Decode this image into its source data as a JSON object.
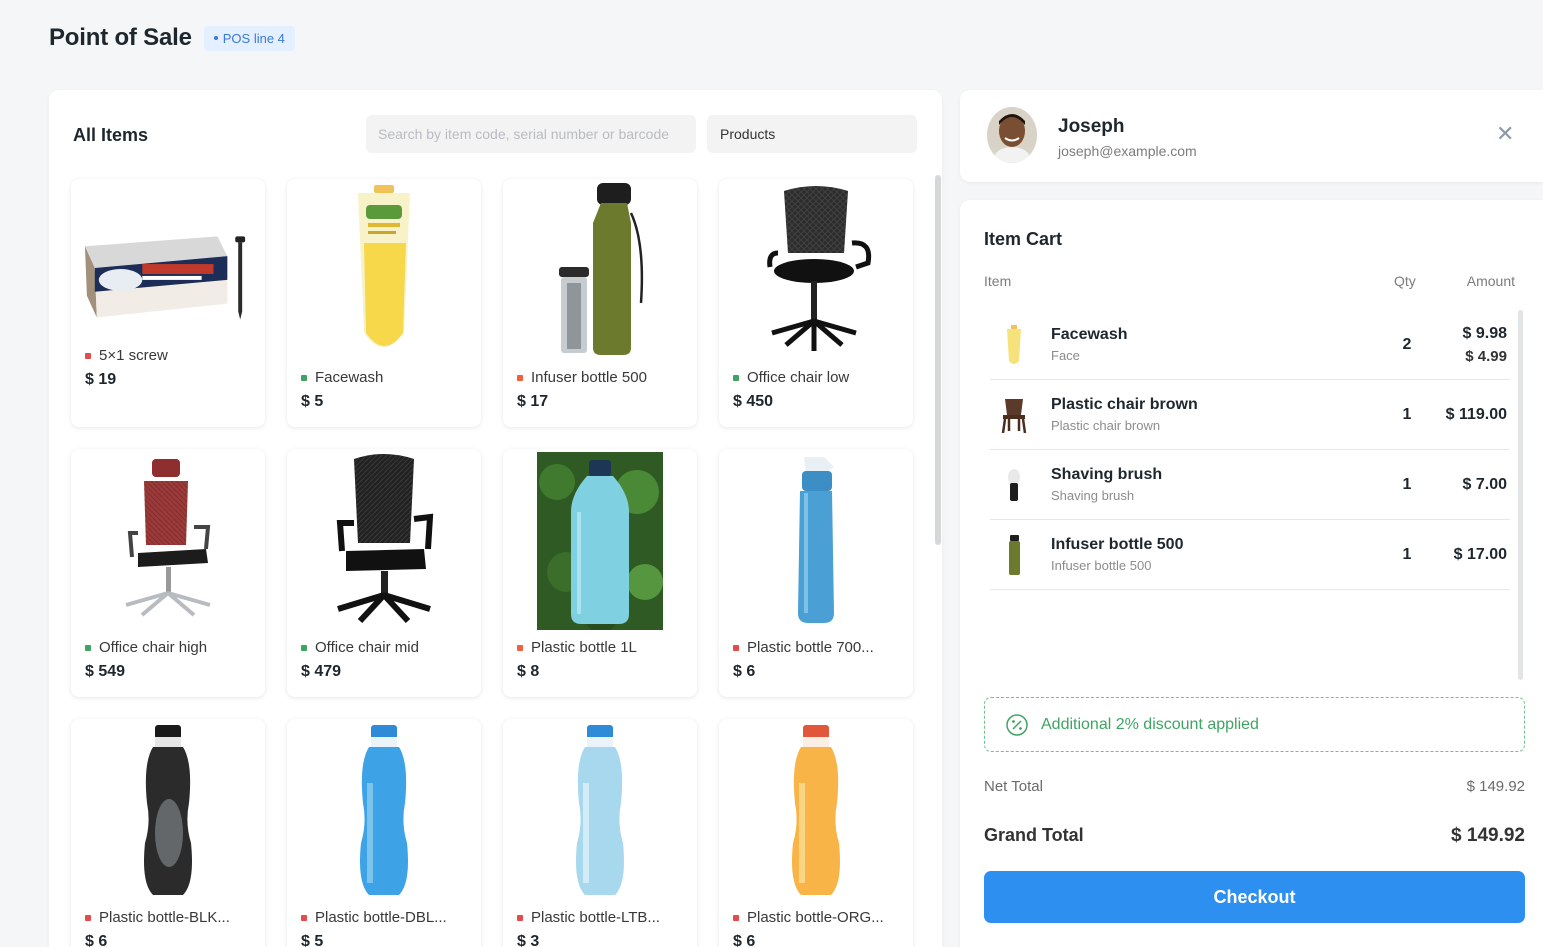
{
  "header": {
    "title": "Point of Sale",
    "pos_badge": "POS line 4"
  },
  "items_panel": {
    "title": "All Items",
    "search_placeholder": "Search by item code, serial number or barcode",
    "item_group": "Products",
    "items": [
      {
        "name": "5×1 screw",
        "price": "$ 19",
        "status_color": "#e24c4c",
        "image": "screw-box"
      },
      {
        "name": "Facewash",
        "price": "$ 5",
        "status_color": "#3fa463",
        "image": "facewash-tube"
      },
      {
        "name": "Infuser bottle 500",
        "price": "$ 17",
        "status_color": "#f0603c",
        "image": "infuser-bottle"
      },
      {
        "name": "Office chair low",
        "price": "$ 450",
        "status_color": "#3fa463",
        "image": "office-chair-low"
      },
      {
        "name": "Office chair high",
        "price": "$ 549",
        "status_color": "#3fa463",
        "image": "office-chair-high"
      },
      {
        "name": "Office chair mid",
        "price": "$ 479",
        "status_color": "#3fa463",
        "image": "office-chair-mid"
      },
      {
        "name": "Plastic bottle 1L",
        "price": "$ 8",
        "status_color": "#f0603c",
        "image": "bottle-1l"
      },
      {
        "name": "Plastic bottle 700...",
        "price": "$ 6",
        "status_color": "#e24c4c",
        "image": "bottle-700"
      },
      {
        "name": "Plastic bottle-BLK...",
        "price": "$ 6",
        "status_color": "#e24c4c",
        "image": "bottle-blk"
      },
      {
        "name": "Plastic bottle-DBL...",
        "price": "$ 5",
        "status_color": "#e24c4c",
        "image": "bottle-dbl"
      },
      {
        "name": "Plastic bottle-LTB...",
        "price": "$ 3",
        "status_color": "#e24c4c",
        "image": "bottle-ltb"
      },
      {
        "name": "Plastic bottle-ORG...",
        "price": "$ 6",
        "status_color": "#e24c4c",
        "image": "bottle-org"
      }
    ]
  },
  "customer": {
    "name": "Joseph",
    "email": "joseph@example.com",
    "close_icon": "close-icon"
  },
  "cart": {
    "title": "Item Cart",
    "col_item": "Item",
    "col_qty": "Qty",
    "col_amount": "Amount",
    "rows": [
      {
        "name": "Facewash",
        "desc": "Face",
        "qty": "2",
        "amount": "$ 9.98",
        "rate": "$ 4.99"
      },
      {
        "name": "Plastic chair brown",
        "desc": "Plastic chair brown",
        "qty": "1",
        "amount": "$ 119.00"
      },
      {
        "name": "Shaving brush",
        "desc": "Shaving brush",
        "qty": "1",
        "amount": "$ 7.00"
      },
      {
        "name": "Infuser bottle 500",
        "desc": "Infuser bottle 500",
        "qty": "1",
        "amount": "$ 17.00"
      }
    ],
    "discount_text": "Additional 2% discount applied",
    "net_total_label": "Net Total",
    "net_total_value": "$ 149.92",
    "grand_total_label": "Grand Total",
    "grand_total_value": "$ 149.92",
    "checkout_label": "Checkout"
  },
  "colors": {
    "accent": "#2d8ff0",
    "success": "#3fa463",
    "badge_bg": "#e4efff",
    "badge_text": "#3a7ad9"
  }
}
